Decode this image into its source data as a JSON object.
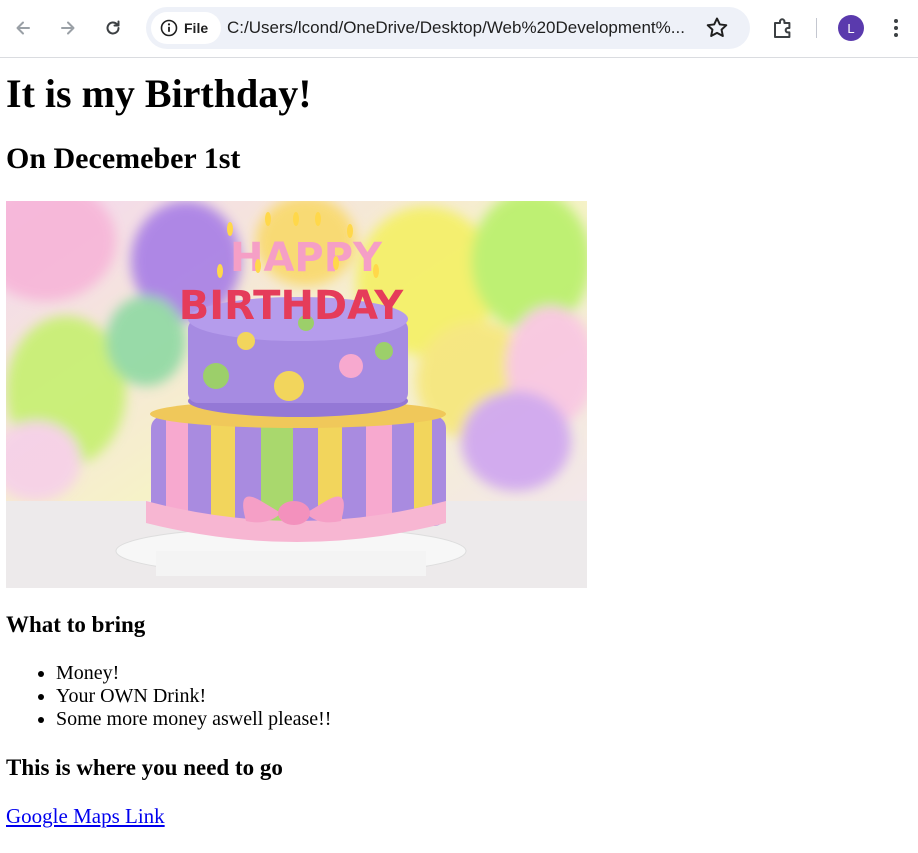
{
  "browser": {
    "site_chip_label": "File",
    "url": "C:/Users/lcond/OneDrive/Desktop/Web%20Development%...",
    "avatar_letter": "L",
    "accent_color": "#5a3aad"
  },
  "page": {
    "title": "It is my Birthday!",
    "subtitle": "On Decemeber 1st",
    "image_letters": [
      "HAPPY",
      "BIRTHDAY"
    ],
    "bring_heading": "What to bring",
    "bring_items": [
      "Money!",
      "Your OWN Drink!",
      "Some more money aswell please!!"
    ],
    "where_heading": "This is where you need to go",
    "maps_link": "Google Maps Link"
  },
  "icons": {
    "back": "arrow-left-icon",
    "forward": "arrow-right-icon",
    "reload": "reload-icon",
    "info": "info-icon",
    "star": "star-icon",
    "extensions": "puzzle-icon",
    "menu": "kebab-menu-icon"
  }
}
